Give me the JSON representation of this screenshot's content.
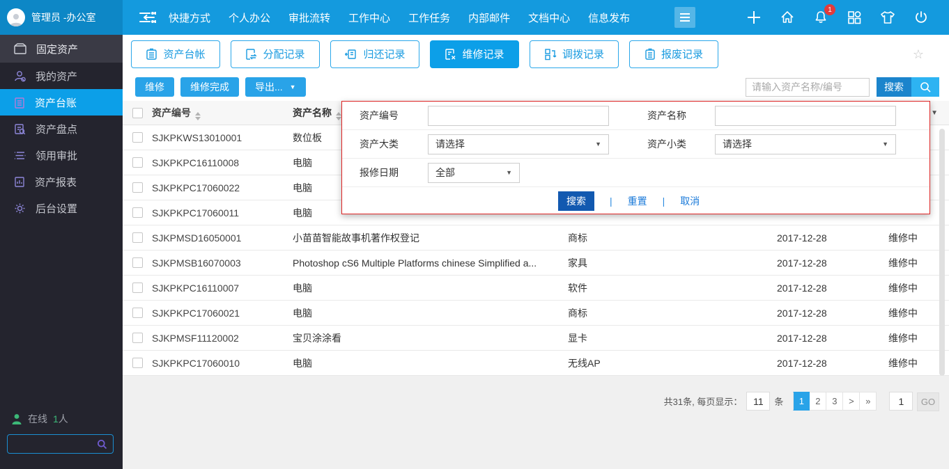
{
  "colors": {
    "topbar": "#149ade",
    "topbar_left": "#0d87c6",
    "accent": "#0c9fe8",
    "sidebar": "#24242e",
    "popup_border": "#dd2424",
    "dark_button": "#1259b0",
    "link": "#1a7ad9",
    "online_green": "#3cb878",
    "badge_red": "#e23b3b"
  },
  "icons": {
    "star": "☆",
    "caret_down": "▼",
    "plus": "+",
    "page_next": ">",
    "page_last": "»",
    "footer_separator": "|"
  },
  "topbar": {
    "user": "管理员 -办公室",
    "nav": [
      "快捷方式",
      "个人办公",
      "审批流转",
      "工作中心",
      "工作任务",
      "内部邮件",
      "文档中心",
      "信息发布"
    ],
    "notification_count": "1"
  },
  "sidebar": {
    "module": "固定资产",
    "items": [
      "我的资产",
      "资产台账",
      "资产盘点",
      "领用审批",
      "资产报表",
      "后台设置"
    ],
    "active_item": "资产台账",
    "online_label": "在线",
    "online_count": "1",
    "online_unit": "人"
  },
  "tabs": [
    "资产台帐",
    "分配记录",
    "归还记录",
    "维修记录",
    "调拨记录",
    "报废记录"
  ],
  "active_tab": "维修记录",
  "toolbar": {
    "repair": "维修",
    "repair_done": "维修完成",
    "export": "导出...",
    "search_placeholder": "请输入资产名称/编号",
    "search": "搜索"
  },
  "filter_popup": {
    "code_label": "资产编号",
    "code_value": "",
    "name_label": "资产名称",
    "name_value": "",
    "major_label": "资产大类",
    "major_value": "请选择",
    "minor_label": "资产小类",
    "minor_value": "请选择",
    "date_label": "报修日期",
    "date_value": "全部",
    "search": "搜索",
    "reset": "重置",
    "cancel": "取消"
  },
  "table": {
    "headers": {
      "code": "资产编号",
      "name": "资产名称"
    },
    "rows": [
      {
        "code": "SJKPKWS13010001",
        "name": "数位板",
        "category": "",
        "date": "",
        "status": ""
      },
      {
        "code": "SJKPKPC16110008",
        "name": "电脑",
        "category": "",
        "date": "",
        "status": ""
      },
      {
        "code": "SJKPKPC17060022",
        "name": "电脑",
        "category": "",
        "date": "",
        "status": ""
      },
      {
        "code": "SJKPKPC17060011",
        "name": "电脑",
        "category": "",
        "date": "",
        "status": ""
      },
      {
        "code": "SJKPMSD16050001",
        "name": "小苗苗智能故事机著作权登记",
        "category": "商标",
        "date": "2017-12-28",
        "status": "维修中"
      },
      {
        "code": "SJKPMSB16070003",
        "name": "Photoshop cS6 Multiple Platforms chinese Simplified a...",
        "category": "家具",
        "date": "2017-12-28",
        "status": "维修中"
      },
      {
        "code": "SJKPKPC16110007",
        "name": "电脑",
        "category": "软件",
        "date": "2017-12-28",
        "status": "维修中"
      },
      {
        "code": "SJKPKPC17060021",
        "name": "电脑",
        "category": "商标",
        "date": "2017-12-28",
        "status": "维修中"
      },
      {
        "code": "SJKPMSF11120002",
        "name": "宝贝涂涂看",
        "category": "显卡",
        "date": "2017-12-28",
        "status": "维修中"
      },
      {
        "code": "SJKPKPC17060010",
        "name": "电脑",
        "category": "无线AP",
        "date": "2017-12-28",
        "status": "维修中"
      }
    ]
  },
  "pagination": {
    "summary": "共31条, 每页显示：",
    "page_size": "11",
    "unit": "条",
    "pages": [
      "1",
      "2",
      "3"
    ],
    "current_page": "1",
    "goto_value": "1",
    "go_label": "GO"
  }
}
